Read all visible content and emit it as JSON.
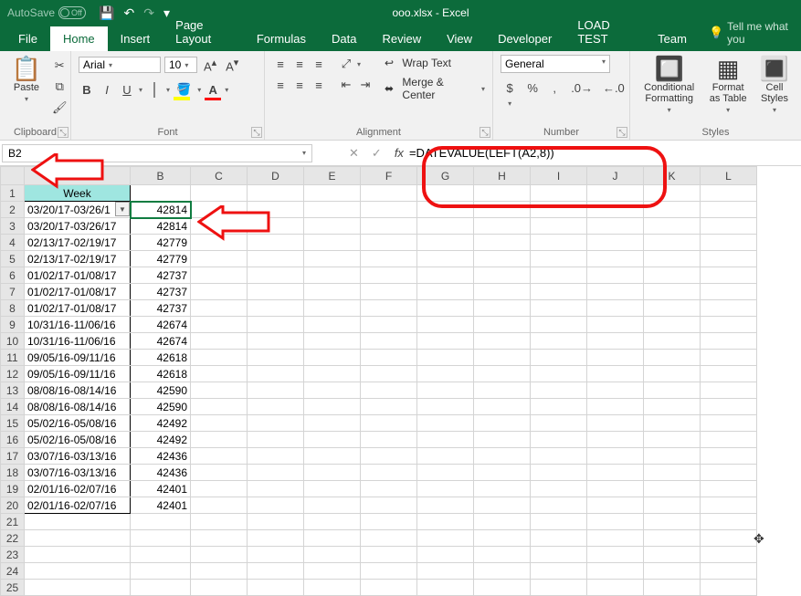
{
  "title": "ooo.xlsx - Excel",
  "autosave_label": "AutoSave",
  "autosave_state": "Off",
  "tabs": {
    "file": "File",
    "home": "Home",
    "insert": "Insert",
    "page_layout": "Page Layout",
    "formulas": "Formulas",
    "data": "Data",
    "review": "Review",
    "view": "View",
    "developer": "Developer",
    "load_test": "LOAD TEST",
    "team": "Team"
  },
  "tell_me": "Tell me what you",
  "ribbon": {
    "clipboard": {
      "paste": "Paste",
      "label": "Clipboard"
    },
    "font": {
      "name": "Arial",
      "size": "10",
      "label": "Font"
    },
    "alignment": {
      "wrap": "Wrap Text",
      "merge": "Merge & Center",
      "label": "Alignment"
    },
    "number": {
      "format": "General",
      "label": "Number"
    },
    "styles": {
      "cf": "Conditional\nFormatting",
      "fat": "Format as\nTable",
      "cs": "Cell\nStyles",
      "label": "Styles"
    }
  },
  "namebox": "B2",
  "formula": "=DATEVALUE(LEFT(A2,8))",
  "columns": [
    "A",
    "B",
    "C",
    "D",
    "E",
    "F",
    "G",
    "H",
    "I",
    "J",
    "K",
    "L"
  ],
  "header_cell": "Week",
  "rows": [
    {
      "r": 2,
      "a": "03/20/17-03/26/1",
      "b": "42814"
    },
    {
      "r": 3,
      "a": "03/20/17-03/26/17",
      "b": "42814"
    },
    {
      "r": 4,
      "a": "02/13/17-02/19/17",
      "b": "42779"
    },
    {
      "r": 5,
      "a": "02/13/17-02/19/17",
      "b": "42779"
    },
    {
      "r": 6,
      "a": "01/02/17-01/08/17",
      "b": "42737"
    },
    {
      "r": 7,
      "a": "01/02/17-01/08/17",
      "b": "42737"
    },
    {
      "r": 8,
      "a": "01/02/17-01/08/17",
      "b": "42737"
    },
    {
      "r": 9,
      "a": "10/31/16-11/06/16",
      "b": "42674"
    },
    {
      "r": 10,
      "a": "10/31/16-11/06/16",
      "b": "42674"
    },
    {
      "r": 11,
      "a": "09/05/16-09/11/16",
      "b": "42618"
    },
    {
      "r": 12,
      "a": "09/05/16-09/11/16",
      "b": "42618"
    },
    {
      "r": 13,
      "a": "08/08/16-08/14/16",
      "b": "42590"
    },
    {
      "r": 14,
      "a": "08/08/16-08/14/16",
      "b": "42590"
    },
    {
      "r": 15,
      "a": "05/02/16-05/08/16",
      "b": "42492"
    },
    {
      "r": 16,
      "a": "05/02/16-05/08/16",
      "b": "42492"
    },
    {
      "r": 17,
      "a": "03/07/16-03/13/16",
      "b": "42436"
    },
    {
      "r": 18,
      "a": "03/07/16-03/13/16",
      "b": "42436"
    },
    {
      "r": 19,
      "a": "02/01/16-02/07/16",
      "b": "42401"
    },
    {
      "r": 20,
      "a": "02/01/16-02/07/16",
      "b": "42401"
    }
  ],
  "empty_rows": [
    21,
    22,
    23,
    24,
    25
  ]
}
